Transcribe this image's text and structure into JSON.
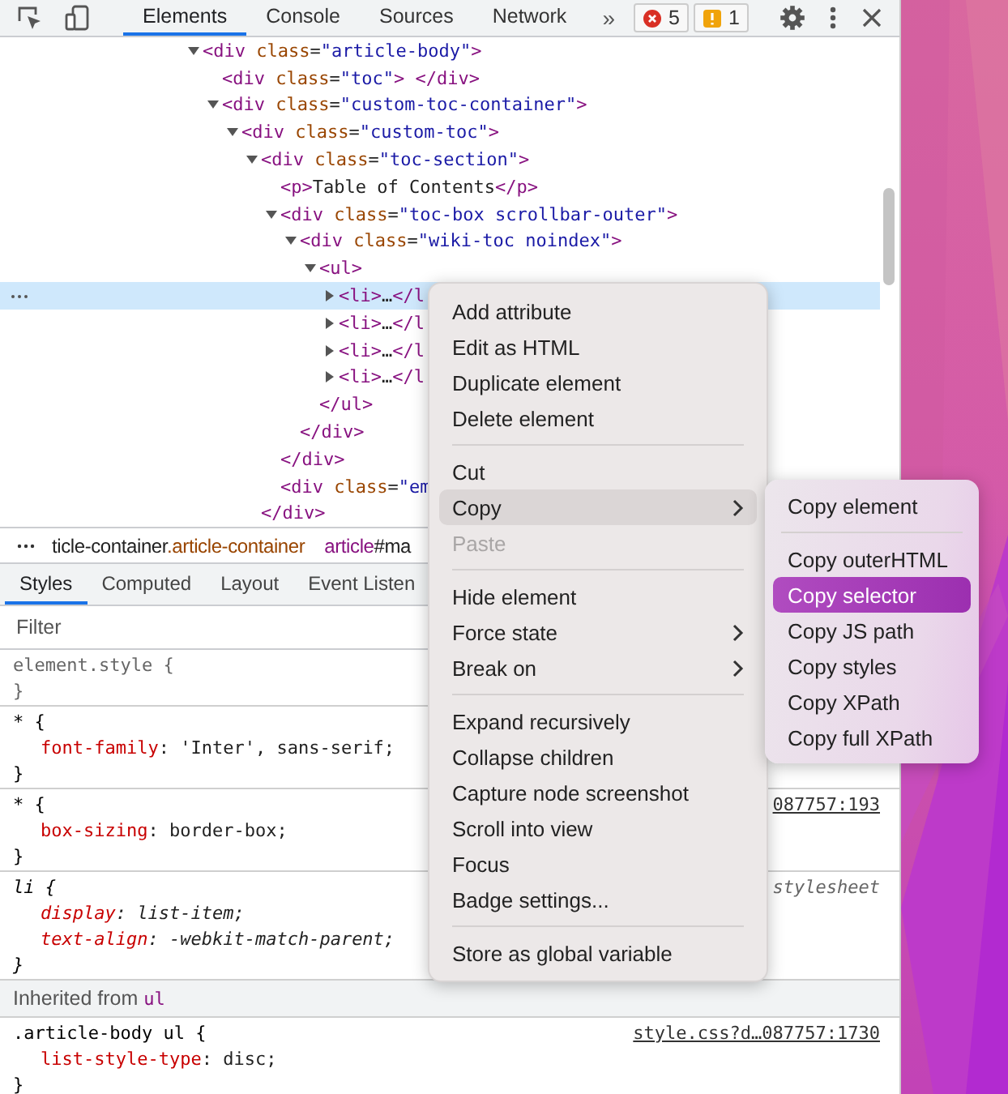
{
  "toolbar": {
    "tabs": [
      {
        "label": "Elements",
        "selected": true
      },
      {
        "label": "Console",
        "selected": false
      },
      {
        "label": "Sources",
        "selected": false
      },
      {
        "label": "Network",
        "selected": false
      }
    ],
    "more": "»",
    "errors": "5",
    "warnings": "1"
  },
  "dom_tree": [
    {
      "kind": "parent",
      "text": "<div class=\"article-body\">",
      "expanded": true,
      "selected": false,
      "children": [
        {
          "kind": "leaf",
          "text": "<div class=\"toc\"> </div>",
          "selected": false
        },
        {
          "kind": "parent",
          "text": "<div class=\"custom-toc-container\">",
          "expanded": true,
          "selected": false,
          "children": [
            {
              "kind": "parent",
              "text": "<div class=\"custom-toc\">",
              "expanded": true,
              "selected": false,
              "children": [
                {
                  "kind": "parent",
                  "text": "<div class=\"toc-section\">",
                  "expanded": true,
                  "selected": false,
                  "closing": "</div>",
                  "children": [
                    {
                      "kind": "leaf",
                      "text": "<p>Table of Contents</p>",
                      "selected": false
                    },
                    {
                      "kind": "parent",
                      "text": "<div class=\"toc-box scrollbar-outer\">",
                      "expanded": true,
                      "selected": false,
                      "closing": "</div>",
                      "children": [
                        {
                          "kind": "parent",
                          "text": "<div class=\"wiki-toc noindex\">",
                          "expanded": true,
                          "selected": false,
                          "closing": "</div>",
                          "children": [
                            {
                              "kind": "parent",
                              "text": "<ul>",
                              "expanded": true,
                              "selected": false,
                              "closing": "</ul>",
                              "children": [
                                {
                                  "kind": "parent",
                                  "text": "<li>…</l",
                                  "expanded": false,
                                  "selected": true
                                },
                                {
                                  "kind": "parent",
                                  "text": "<li>…</l",
                                  "expanded": false,
                                  "selected": false
                                },
                                {
                                  "kind": "parent",
                                  "text": "<li>…</l",
                                  "expanded": false,
                                  "selected": false
                                },
                                {
                                  "kind": "parent",
                                  "text": "<li>…</l",
                                  "expanded": false,
                                  "selected": false
                                }
                              ]
                            }
                          ]
                        }
                      ]
                    },
                    {
                      "kind": "leaf",
                      "text": "<div class=\"em",
                      "selected": false
                    }
                  ]
                }
              ]
            }
          ]
        }
      ]
    }
  ],
  "breadcrumbs": [
    {
      "tag": "ticle-container",
      "suffix": ".article-container"
    },
    {
      "tag": "article",
      "suffix": "#ma"
    }
  ],
  "styles_tabs": [
    {
      "label": "Styles",
      "selected": true
    },
    {
      "label": "Computed",
      "selected": false
    },
    {
      "label": "Layout",
      "selected": false
    },
    {
      "label": "Event Listen",
      "selected": false
    }
  ],
  "filter": {
    "placeholder": "Filter"
  },
  "rules": [
    {
      "kind": "inline",
      "selector": "element.style {",
      "close": "}"
    },
    {
      "kind": "author",
      "selector": "* {",
      "close": "}",
      "declarations": [
        "font-family: 'Inter', sans-serif;"
      ]
    },
    {
      "kind": "author",
      "selector": "* {",
      "source": "087757:193",
      "close": "}",
      "declarations": [
        "box-sizing: border-box;"
      ]
    },
    {
      "kind": "user-agent",
      "selector": "li {",
      "source": "stylesheet",
      "close": "}",
      "declarations": [
        "display: list-item;",
        "text-align: -webkit-match-parent;"
      ]
    }
  ],
  "inherited": {
    "label": "Inherited from",
    "tag": "ul"
  },
  "inherited_rules": [
    {
      "kind": "author",
      "selector": ".article-body ul {",
      "source": "style.css?d…087757:1730",
      "close": "}",
      "declarations": [
        "list-style-type: disc;"
      ]
    }
  ],
  "context_menu": [
    {
      "kind": "item",
      "label": "Add attribute",
      "selected": false,
      "disabled": false,
      "submenu": false
    },
    {
      "kind": "item",
      "label": "Edit as HTML",
      "selected": false,
      "disabled": false,
      "submenu": false
    },
    {
      "kind": "item",
      "label": "Duplicate element",
      "selected": false,
      "disabled": false,
      "submenu": false
    },
    {
      "kind": "item",
      "label": "Delete element",
      "selected": false,
      "disabled": false,
      "submenu": false
    },
    {
      "kind": "separator"
    },
    {
      "kind": "item",
      "label": "Cut",
      "selected": false,
      "disabled": false,
      "submenu": false
    },
    {
      "kind": "item",
      "label": "Copy",
      "selected": true,
      "disabled": false,
      "submenu": true
    },
    {
      "kind": "item",
      "label": "Paste",
      "selected": false,
      "disabled": true,
      "submenu": false
    },
    {
      "kind": "separator"
    },
    {
      "kind": "item",
      "label": "Hide element",
      "selected": false,
      "disabled": false,
      "submenu": false
    },
    {
      "kind": "item",
      "label": "Force state",
      "selected": false,
      "disabled": false,
      "submenu": true
    },
    {
      "kind": "item",
      "label": "Break on",
      "selected": false,
      "disabled": false,
      "submenu": true
    },
    {
      "kind": "separator"
    },
    {
      "kind": "item",
      "label": "Expand recursively",
      "selected": false,
      "disabled": false,
      "submenu": false
    },
    {
      "kind": "item",
      "label": "Collapse children",
      "selected": false,
      "disabled": false,
      "submenu": false
    },
    {
      "kind": "item",
      "label": "Capture node screenshot",
      "selected": false,
      "disabled": false,
      "submenu": false
    },
    {
      "kind": "item",
      "label": "Scroll into view",
      "selected": false,
      "disabled": false,
      "submenu": false
    },
    {
      "kind": "item",
      "label": "Focus",
      "selected": false,
      "disabled": false,
      "submenu": false
    },
    {
      "kind": "item",
      "label": "Badge settings...",
      "selected": false,
      "disabled": false,
      "submenu": false
    },
    {
      "kind": "separator"
    },
    {
      "kind": "item",
      "label": "Store as global variable",
      "selected": false,
      "disabled": false,
      "submenu": false
    }
  ],
  "copy_submenu": [
    {
      "kind": "item",
      "label": "Copy element",
      "selected": false
    },
    {
      "kind": "separator"
    },
    {
      "kind": "item",
      "label": "Copy outerHTML",
      "selected": false
    },
    {
      "kind": "item",
      "label": "Copy selector",
      "selected": true
    },
    {
      "kind": "item",
      "label": "Copy JS path",
      "selected": false
    },
    {
      "kind": "item",
      "label": "Copy styles",
      "selected": false
    },
    {
      "kind": "item",
      "label": "Copy XPath",
      "selected": false
    },
    {
      "kind": "item",
      "label": "Copy full XPath",
      "selected": false
    }
  ]
}
